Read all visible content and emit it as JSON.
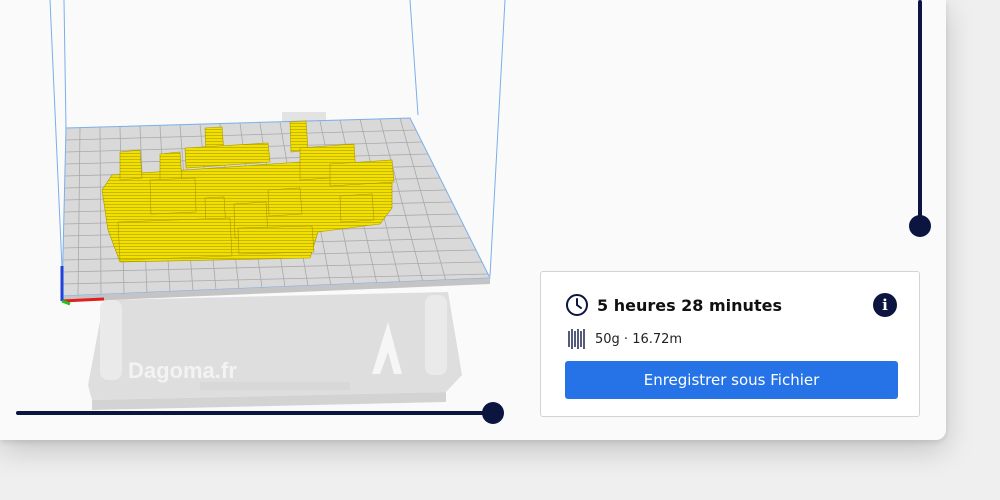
{
  "print_info": {
    "time_estimate": "5 heures 28 minutes",
    "material": "50g · 16.72m",
    "save_button_label": "Enregistrer sous Fichier"
  },
  "printer_base": {
    "brand_text": "Dagoma.fr"
  },
  "icons": {
    "clock": "clock-icon",
    "info": "info-icon",
    "spool": "filament-icon"
  },
  "colors": {
    "model": "#f5e000",
    "slider": "#0b1540",
    "accent": "#2573e6",
    "axis_x": "#e02020",
    "axis_y": "#2040e0",
    "axis_z": "#20c020"
  }
}
